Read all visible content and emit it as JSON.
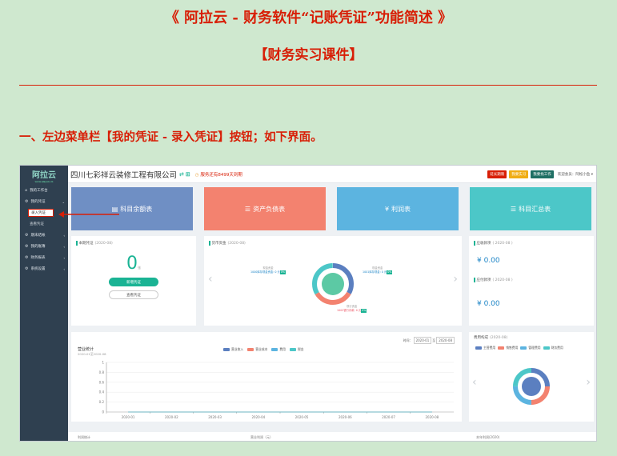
{
  "document": {
    "title": "《 阿拉云 - 财务软件“记账凭证”功能简述 》",
    "subtitle": "【财务实习课件】",
    "section_heading": "一、左边菜单栏【我的凭证 - 录入凭证】按钮；如下界面。"
  },
  "colors": {
    "doc_red": "#d81e06",
    "sidebar_bg": "#2f4050",
    "accent_green": "#1ab394",
    "card_blue": "#6f8fc4",
    "card_salmon": "#f3826f",
    "card_sky": "#5cb4e0",
    "card_teal": "#4cc7c8"
  },
  "app": {
    "logo": "阿拉云",
    "logo_tagline": "www.alayun.cn",
    "company": "四川七彩祥云装修工程有限公司",
    "swap_icon": "⇄",
    "add_icon": "⊞",
    "expire_notice": "服务还有8499天到期",
    "top_buttons": [
      {
        "label": "延长期限",
        "color": "#d81e06"
      },
      {
        "label": "我要实习",
        "color": "#f0ad14"
      },
      {
        "label": "我要找工作",
        "color": "#1f6f64"
      }
    ],
    "welcome": "欢迎会员：阿松小鱼 ▾",
    "sidebar": {
      "items": [
        {
          "icon": "home-icon",
          "glyph": "⌂",
          "label": "我的工作台",
          "sub": false,
          "active": false,
          "caret": ""
        },
        {
          "icon": "gear-icon",
          "glyph": "⚙",
          "label": "我的凭证",
          "sub": false,
          "active": false,
          "caret": "⌄"
        },
        {
          "icon": "",
          "glyph": "",
          "label": "录入凭证",
          "sub": true,
          "active": true,
          "caret": ""
        },
        {
          "icon": "",
          "glyph": "",
          "label": "查看凭证",
          "sub": true,
          "active": false,
          "caret": ""
        },
        {
          "icon": "gear-icon",
          "glyph": "⚙",
          "label": "期末结帐",
          "sub": false,
          "active": false,
          "caret": "‹"
        },
        {
          "icon": "gear-icon",
          "glyph": "⚙",
          "label": "我的账簿",
          "sub": false,
          "active": false,
          "caret": "‹"
        },
        {
          "icon": "gear-icon",
          "glyph": "⚙",
          "label": "财务报表",
          "sub": false,
          "active": false,
          "caret": "‹"
        },
        {
          "icon": "gear-icon",
          "glyph": "⚙",
          "label": "系统设置",
          "sub": false,
          "active": false,
          "caret": "‹"
        }
      ]
    },
    "cards": [
      {
        "icon": "list-icon",
        "glyph": "▤",
        "label": "科目余额表",
        "color": "#6f8fc4"
      },
      {
        "icon": "list-icon",
        "glyph": "☰",
        "label": "资产负债表",
        "color": "#f3826f"
      },
      {
        "icon": "yen-icon",
        "glyph": "¥",
        "label": "利润表",
        "color": "#5cb4e0"
      },
      {
        "icon": "list-icon",
        "glyph": "☰",
        "label": "科目汇总表",
        "color": "#4cc7c8"
      }
    ],
    "voucher_panel": {
      "title": "本期凭证",
      "period": "(2020-08)",
      "count": "0",
      "unit": "张",
      "add_button": "新增凭证",
      "view_button": "查看凭证"
    },
    "cash_panel": {
      "title": "货币资金",
      "period": "(2020-08)",
      "callouts": [
        {
          "label": "现金资金",
          "detail": "1000库存现金资金: 0 元",
          "pct": "0%"
        },
        {
          "label": "现金资金",
          "detail": "1001库存现金: 0 元",
          "pct": "0%"
        },
        {
          "label": "现行资金",
          "detail": "1002银行存款: 0 元",
          "pct": "0%"
        }
      ]
    },
    "receivable_panel": {
      "receivable_title": "应收款项",
      "receivable_period": "( 2020-08 )",
      "receivable_value": "¥ 0.00",
      "payable_title": "应付款项",
      "payable_period": "( 2020-08 )",
      "payable_value": "¥ 0.00"
    },
    "operating_panel": {
      "title": "营业统计",
      "subtitle": "2020-01至2020-08",
      "time_label": "时间：",
      "date_from": "2020-01",
      "date_sep": "至",
      "date_to": "2020-08"
    },
    "expense_panel": {
      "title": "费用构成",
      "period": "(2020-08)"
    },
    "bottom_labels": [
      "利润统计",
      "营业利润（元）",
      "本年利润(2020)"
    ]
  },
  "chart_data": [
    {
      "type": "line",
      "title": "营业统计",
      "subtitle": "2020-01至2020-08",
      "categories": [
        "2020-01",
        "2020-02",
        "2020-03",
        "2020-04",
        "2020-05",
        "2020-06",
        "2020-07",
        "2020-08"
      ],
      "yticks": [
        "1",
        "0.8",
        "0.6",
        "0.4",
        "0.2",
        "0"
      ],
      "ylim": [
        0,
        1
      ],
      "legend_position": "top-center",
      "series": [
        {
          "name": "营业收入",
          "color": "#5b7fc0",
          "values": [
            0,
            0,
            0,
            0,
            0,
            0,
            0,
            0
          ]
        },
        {
          "name": "营业成本",
          "color": "#f3826f",
          "values": [
            0,
            0,
            0,
            0,
            0,
            0,
            0,
            0
          ]
        },
        {
          "name": "费用",
          "color": "#5cb4e0",
          "values": [
            0,
            0,
            0,
            0,
            0,
            0,
            0,
            0
          ]
        },
        {
          "name": "税金",
          "color": "#4cc7c8",
          "values": [
            0,
            0,
            0,
            0,
            0,
            0,
            0,
            0
          ]
        }
      ]
    },
    {
      "type": "pie",
      "title": "费用构成",
      "legend_position": "top",
      "series": [
        {
          "name": "主营费用",
          "color": "#5b7fc0",
          "values": [
            0
          ]
        },
        {
          "name": "销售费用",
          "color": "#f3826f",
          "values": [
            0
          ]
        },
        {
          "name": "管理费用",
          "color": "#5cb4e0",
          "values": [
            0
          ]
        },
        {
          "name": "财务费用",
          "color": "#4cc7c8",
          "values": [
            0
          ]
        }
      ]
    }
  ]
}
